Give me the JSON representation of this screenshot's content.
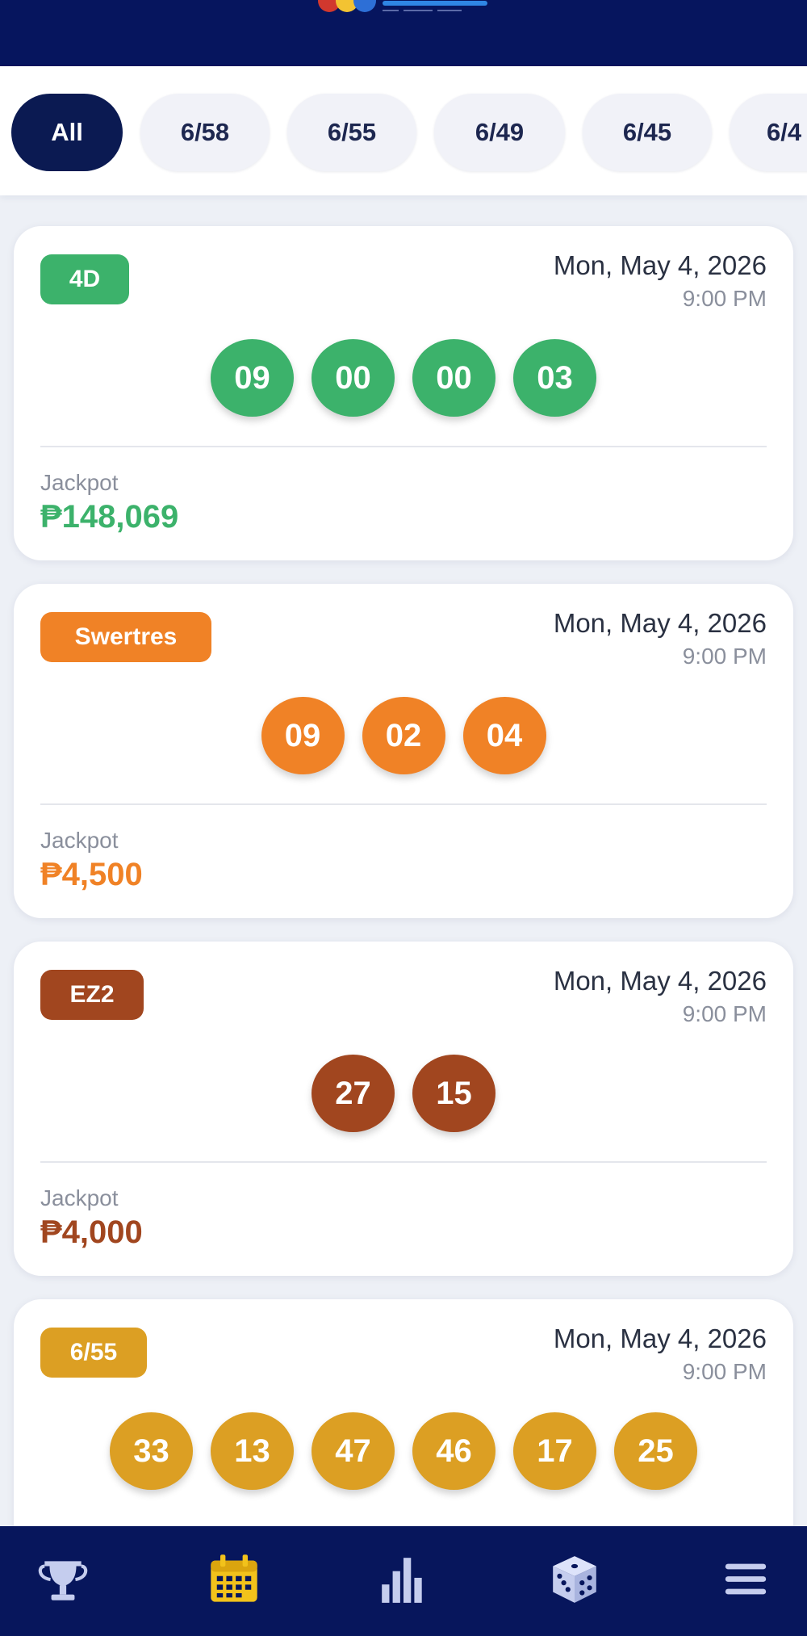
{
  "app": {
    "logo_text": "",
    "colors": {
      "header_bg": "#06155e",
      "nav_bg": "#07165c",
      "active_nav": "#f2c21b",
      "inactive_nav": "#c5cdee"
    }
  },
  "filters": {
    "active": "All",
    "chips": [
      {
        "label": "All"
      },
      {
        "label": "6/58"
      },
      {
        "label": "6/55"
      },
      {
        "label": "6/49"
      },
      {
        "label": "6/45"
      },
      {
        "label": "6/4"
      }
    ]
  },
  "results": [
    {
      "game": "4D",
      "color": "#3cb26b",
      "date": "Mon, May 4, 2026",
      "time": "9:00 PM",
      "numbers": [
        "09",
        "00",
        "00",
        "03"
      ],
      "jackpot_label": "Jackpot",
      "jackpot": "₱148,069"
    },
    {
      "game": "Swertres",
      "color": "#f08226",
      "date": "Mon, May 4, 2026",
      "time": "9:00 PM",
      "numbers": [
        "09",
        "02",
        "04"
      ],
      "jackpot_label": "Jackpot",
      "jackpot": "₱4,500"
    },
    {
      "game": "EZ2",
      "color": "#a1461f",
      "date": "Mon, May 4, 2026",
      "time": "9:00 PM",
      "numbers": [
        "27",
        "15"
      ],
      "jackpot_label": "Jackpot",
      "jackpot": "₱4,000"
    },
    {
      "game": "6/55",
      "color": "#dc9f23",
      "date": "Mon, May 4, 2026",
      "time": "9:00 PM",
      "numbers": [
        "33",
        "13",
        "47",
        "46",
        "17",
        "25"
      ]
    }
  ],
  "nav": {
    "active": "calendar-icon",
    "items": [
      {
        "icon": "trophy-icon"
      },
      {
        "icon": "calendar-icon"
      },
      {
        "icon": "bar-chart-icon"
      },
      {
        "icon": "dice-icon"
      },
      {
        "icon": "menu-icon"
      }
    ]
  }
}
